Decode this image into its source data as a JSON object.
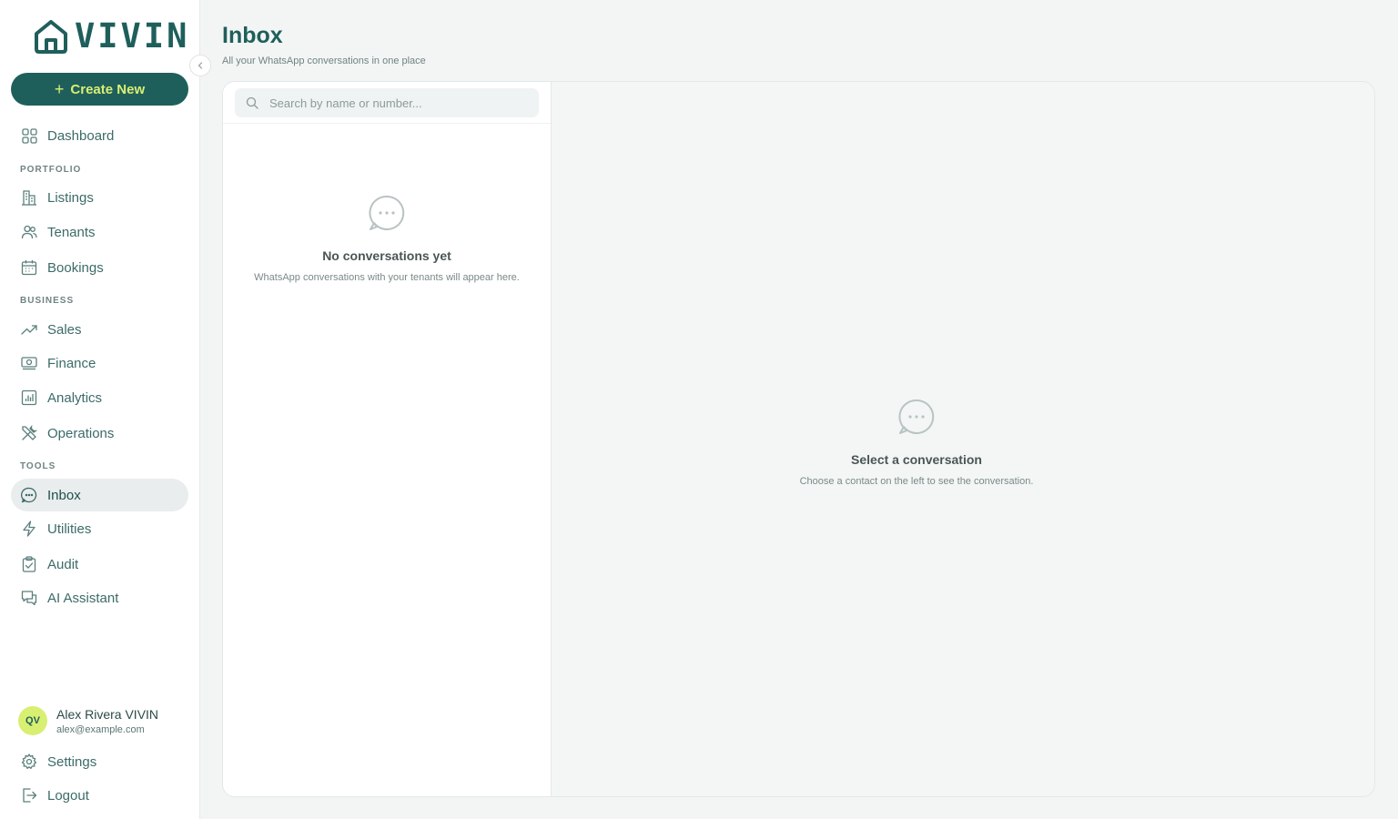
{
  "brand": {
    "name": "VIVIN",
    "accent": "#1f5f5b",
    "highlight": "#d8ef72"
  },
  "sidebar": {
    "create_label": "Create New",
    "dashboard": {
      "label": "Dashboard",
      "icon": "grid-icon"
    },
    "sections": [
      {
        "title": "PORTFOLIO",
        "items": [
          {
            "label": "Listings",
            "icon": "building-icon"
          },
          {
            "label": "Tenants",
            "icon": "users-icon"
          },
          {
            "label": "Bookings",
            "icon": "calendar-icon"
          }
        ]
      },
      {
        "title": "BUSINESS",
        "items": [
          {
            "label": "Sales",
            "icon": "trending-up-icon"
          },
          {
            "label": "Finance",
            "icon": "banknote-icon"
          },
          {
            "label": "Analytics",
            "icon": "bar-chart-icon"
          },
          {
            "label": "Operations",
            "icon": "tools-icon"
          }
        ]
      },
      {
        "title": "TOOLS",
        "items": [
          {
            "label": "Inbox",
            "icon": "message-circle-icon",
            "active": true
          },
          {
            "label": "Utilities",
            "icon": "zap-icon"
          },
          {
            "label": "Audit",
            "icon": "clipboard-check-icon"
          },
          {
            "label": "AI Assistant",
            "icon": "messages-icon"
          }
        ]
      }
    ],
    "user": {
      "initials": "QV",
      "name": "Alex Rivera VIVIN",
      "email": "alex@example.com"
    },
    "settings_label": "Settings",
    "logout_label": "Logout"
  },
  "page": {
    "title": "Inbox",
    "subtitle": "All your WhatsApp conversations in one place"
  },
  "conversations": {
    "search_placeholder": "Search by name or number...",
    "empty_title": "No conversations yet",
    "empty_desc": "WhatsApp conversations with your tenants will appear here."
  },
  "detail": {
    "empty_title": "Select a conversation",
    "empty_desc": "Choose a contact on the left to see the conversation."
  }
}
